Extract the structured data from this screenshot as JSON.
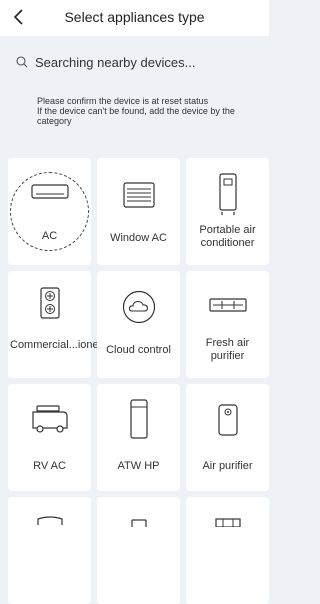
{
  "header": {
    "title": "Select appliances type",
    "back_icon": "chevron-left-icon"
  },
  "search": {
    "status": "Searching nearby devices..."
  },
  "notice": {
    "text": "Please confirm the device is at reset status\n If the device can't be found, add the device by the category"
  },
  "devices": [
    {
      "label": "AC",
      "icon": "split-ac-icon",
      "selected": true
    },
    {
      "label": "Window AC",
      "icon": "window-ac-icon"
    },
    {
      "label": "Portable air conditioner",
      "icon": "portable-ac-icon"
    },
    {
      "label": "Commercial...ioner",
      "icon": "commercial-ac-icon"
    },
    {
      "label": "Cloud control",
      "icon": "cloud-control-icon"
    },
    {
      "label": "Fresh air purifier",
      "icon": "fresh-air-purifier-icon"
    },
    {
      "label": "RV AC",
      "icon": "rv-ac-icon"
    },
    {
      "label": "ATW HP",
      "icon": "atw-hp-icon"
    },
    {
      "label": "Air purifier",
      "icon": "air-purifier-icon"
    }
  ]
}
